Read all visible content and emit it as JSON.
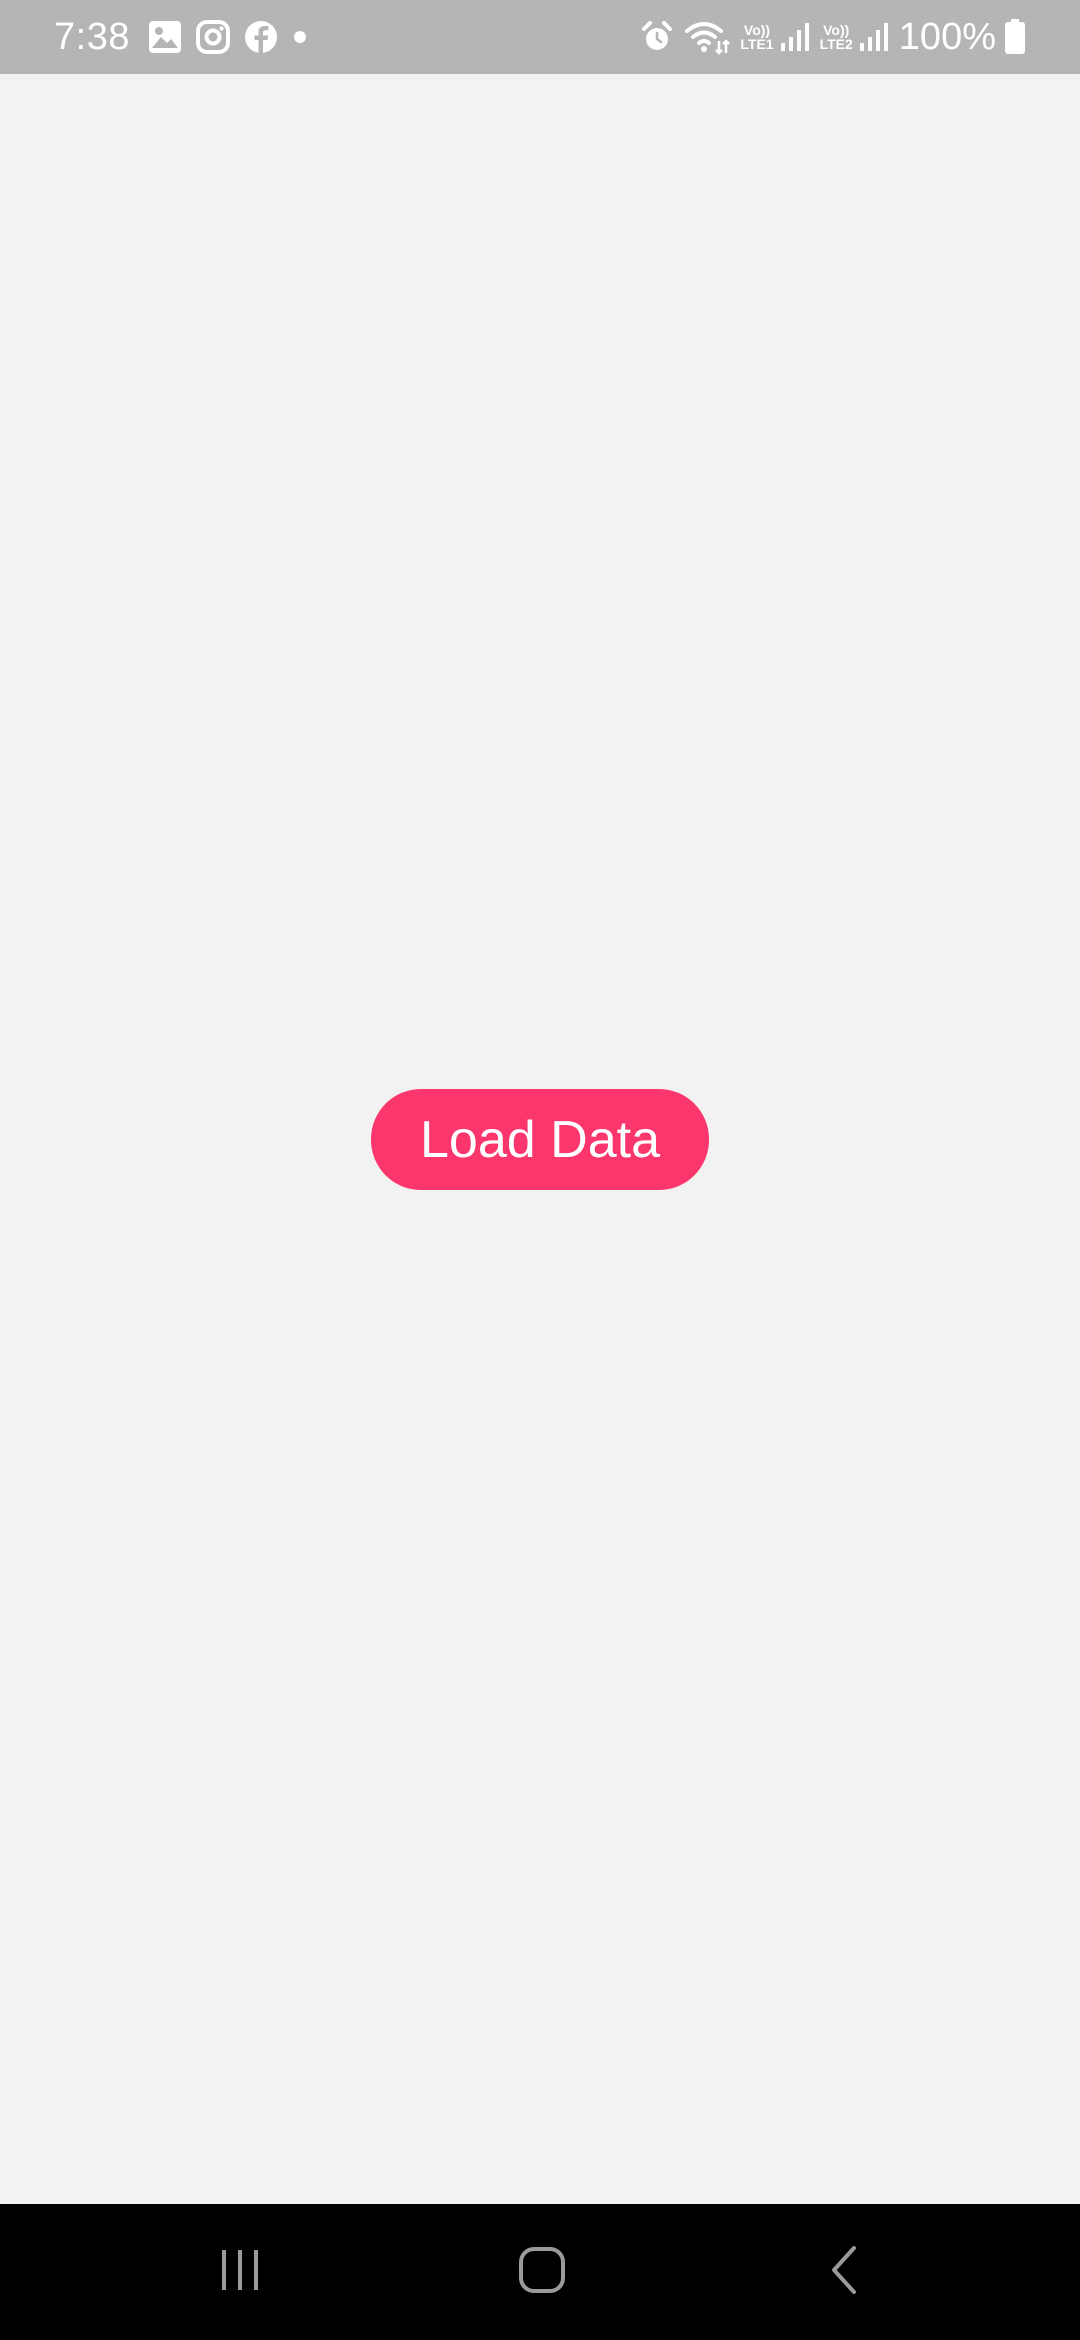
{
  "status_bar": {
    "time": "7:38",
    "battery": "100%",
    "sim1_top": "Vo))",
    "sim1_bottom": "LTE1",
    "sim2_top": "Vo))",
    "sim2_bottom": "LTE2",
    "left_icons": [
      "gallery-icon",
      "instagram-icon",
      "facebook-icon",
      "notification-dot-icon"
    ],
    "right_icons": [
      "alarm-icon",
      "wifi-icon",
      "signal-icon",
      "signal-icon",
      "battery-icon"
    ]
  },
  "main": {
    "load_button_label": "Load Data"
  },
  "nav_bar": {
    "buttons": [
      "recent-apps-icon",
      "home-icon",
      "back-icon"
    ]
  },
  "colors": {
    "status_bar_bg": "#b5b5b5",
    "background": "#f2f2f2",
    "accent": "#fb366d",
    "nav_bar_bg": "#000000"
  }
}
